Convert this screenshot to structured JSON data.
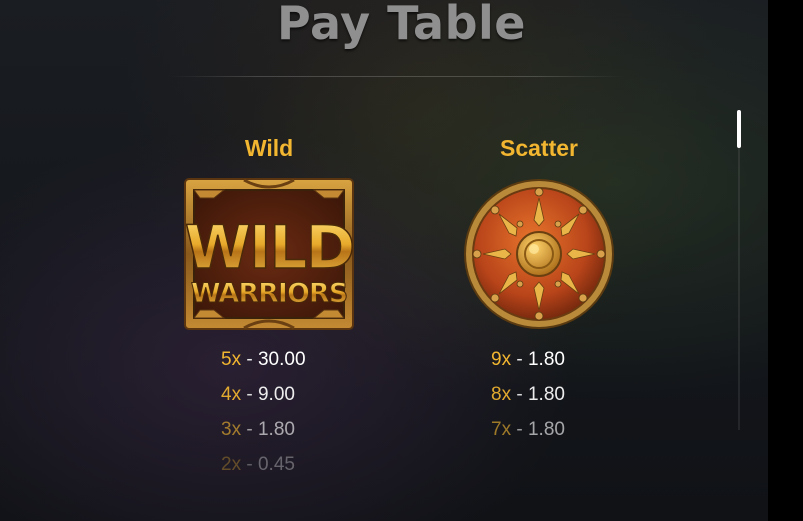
{
  "title": "Pay Table",
  "colors": {
    "accent": "#f2b630",
    "title": "#8f8f8f",
    "text": "#ffffff"
  },
  "symbols": [
    {
      "name": "Wild",
      "icon": "wild-warriors-logo",
      "logo_text": [
        "WILD",
        "WARRIORS"
      ],
      "pays": [
        {
          "mult": "5x",
          "value": "30.00"
        },
        {
          "mult": "4x",
          "value": "9.00"
        },
        {
          "mult": "3x",
          "value": "1.80"
        },
        {
          "mult": "2x",
          "value": "0.45"
        }
      ]
    },
    {
      "name": "Scatter",
      "icon": "shield-icon",
      "pays": [
        {
          "mult": "9x",
          "value": "1.80"
        },
        {
          "mult": "8x",
          "value": "1.80"
        },
        {
          "mult": "7x",
          "value": "1.80"
        }
      ]
    }
  ]
}
